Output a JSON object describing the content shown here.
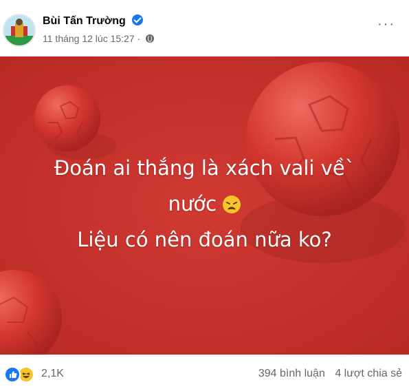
{
  "post": {
    "author": "Bùi Tấn Trường",
    "timestamp": "11 tháng 12 lúc 15:27",
    "more_label": "···",
    "lines": [
      "Đoán ai thắng là xách vali về`",
      "nước",
      "Liệu có nên đoán nữa ko?"
    ],
    "emoji": "weary-face",
    "background_color": "#c8332f"
  },
  "footer": {
    "reaction_count": "2,1K",
    "comments": "394 bình luận",
    "shares": "4 lượt chia sẻ",
    "reactions": [
      "like",
      "haha"
    ]
  },
  "colors": {
    "accent": "#1877f2",
    "muted": "#65676b"
  }
}
